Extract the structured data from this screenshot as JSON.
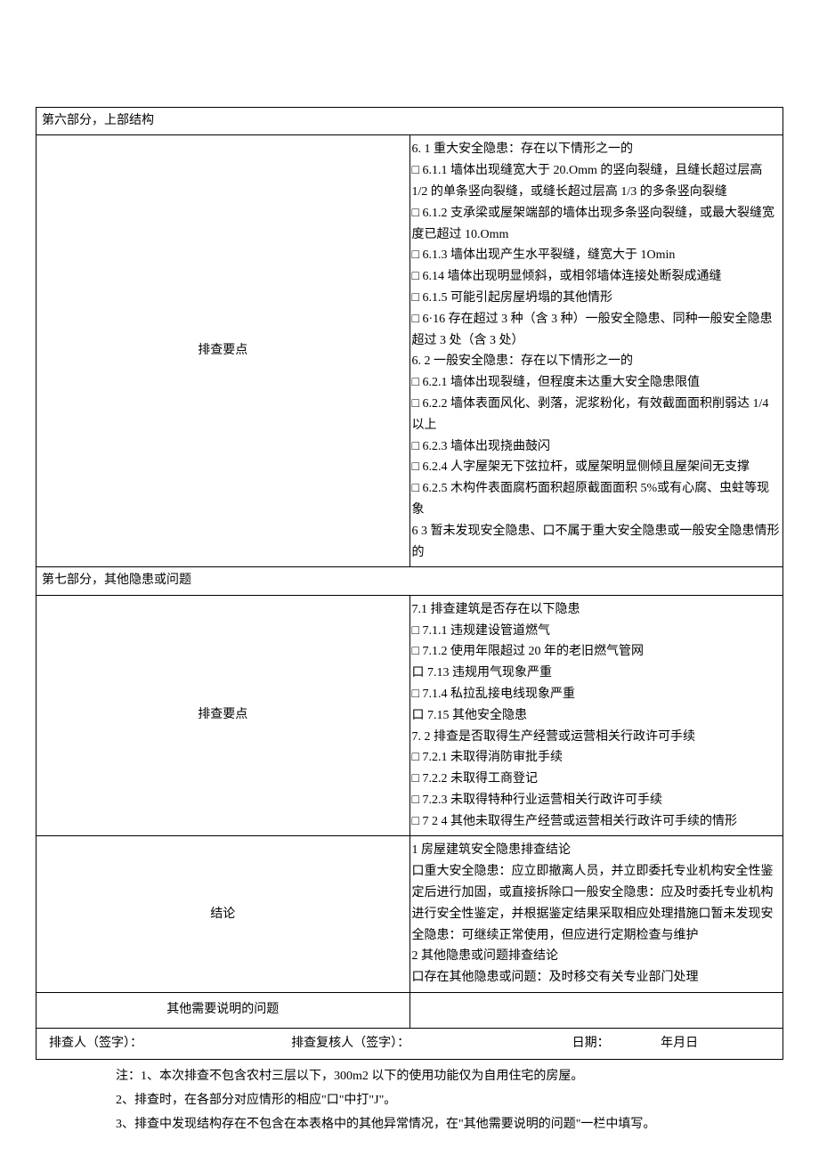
{
  "section6": {
    "header": "第六部分，上部结构",
    "label": "排查要点",
    "lines": [
      "6. 1 重大安全隐患：存在以下情形之一的",
      "□ 6.1.1 墙体出现缝宽大于 20.Omm 的竖向裂缝，且缝长超过层高 1/2 的单条竖向裂缝，或缝长超过层高 1/3 的多条竖向裂缝",
      "□ 6.1.2 支承梁或屋架端部的墙体出现多条竖向裂缝，或最大裂缝宽度已超过 10.Omm",
      "□ 6.1.3 墙体出现产生水平裂缝，缝宽大于 1Omin",
      "□ 6.14 墙体出现明显倾斜，或相邻墙体连接处断裂成通缝",
      "□ 6.1.5 可能引起房屋坍塌的其他情形",
      "□ 6·16 存在超过 3 种（含 3 种）一般安全隐患、同种一般安全隐患超过 3 处（含 3 处）",
      "6. 2 一般安全隐患：存在以下情形之一的",
      "□ 6.2.1 墙体出现裂缝，但程度未达重大安全隐患限值",
      "□ 6.2.2 墙体表面风化、剥落，泥浆粉化，有效截面面积削弱达 1/4 以上",
      "□ 6.2.3 墙体出现挠曲鼓闪",
      "□ 6.2.4 人字屋架无下弦拉杆，或屋架明显侧倾且屋架间无支撑",
      "□ 6.2.5 木构件表面腐朽面积超原截面面积 5%或有心腐、虫蛀等现象",
      "6 3 暂未发现安全隐患、口不属于重大安全隐患或一般安全隐患情形的"
    ]
  },
  "section7": {
    "header": "第七部分，其他隐患或问题",
    "label": "排查要点",
    "lines": [
      "7.1  排查建筑是否存在以下隐患",
      "□ 7.1.1 违规建设管道燃气",
      "□ 7.1.2 使用年限超过 20 年的老旧燃气管网",
      "口 7.13 违规用气现象严重",
      "□ 7.1.4 私拉乱接电线现象严重",
      "口 7.15 其他安全隐患",
      "7. 2 排查是否取得生产经营或运营相关行政许可手续",
      "□ 7.2.1 未取得消防审批手续",
      "□ 7.2.2 未取得工商登记",
      "□ 7.2.3 未取得特种行业运营相关行政许可手续",
      "□ 7 2 4 其他未取得生产经营或运营相关行政许可手续的情形"
    ]
  },
  "conclusion": {
    "label": "结论",
    "lines": [
      "1 房屋建筑安全隐患排查结论",
      "口重大安全隐患：应立即撤离人员，并立即委托专业机构安全性鉴定后进行加固，或直接拆除口一般安全隐患：应及时委托专业机构进行安全性鉴定，并根据鉴定结果采取相应处理措施口暂未发现安全隐患：可继续正常使用，但应进行定期检查与维护",
      "2 其他隐患或问题排查结论",
      "口存在其他隐患或问题：及时移交有关专业部门处理"
    ]
  },
  "other_notes": {
    "label": "其他需要说明的问题"
  },
  "signature": {
    "inspector": "排查人（签字）：",
    "reviewer": "排查复核人（签字）：",
    "date_label": "日期：",
    "date_value": "年月日"
  },
  "footnotes": {
    "l1": "注：1、本次排查不包含农村三层以下，300m2 以下的使用功能仅为自用住宅的房屋。",
    "l2": "2、排查时，在各部分对应情形的相应\"口\"中打\"J\"。",
    "l3": "3、排查中发现结构存在不包含在本表格中的其他异常情况，在\"其他需要说明的问题\"一栏中填写。"
  }
}
